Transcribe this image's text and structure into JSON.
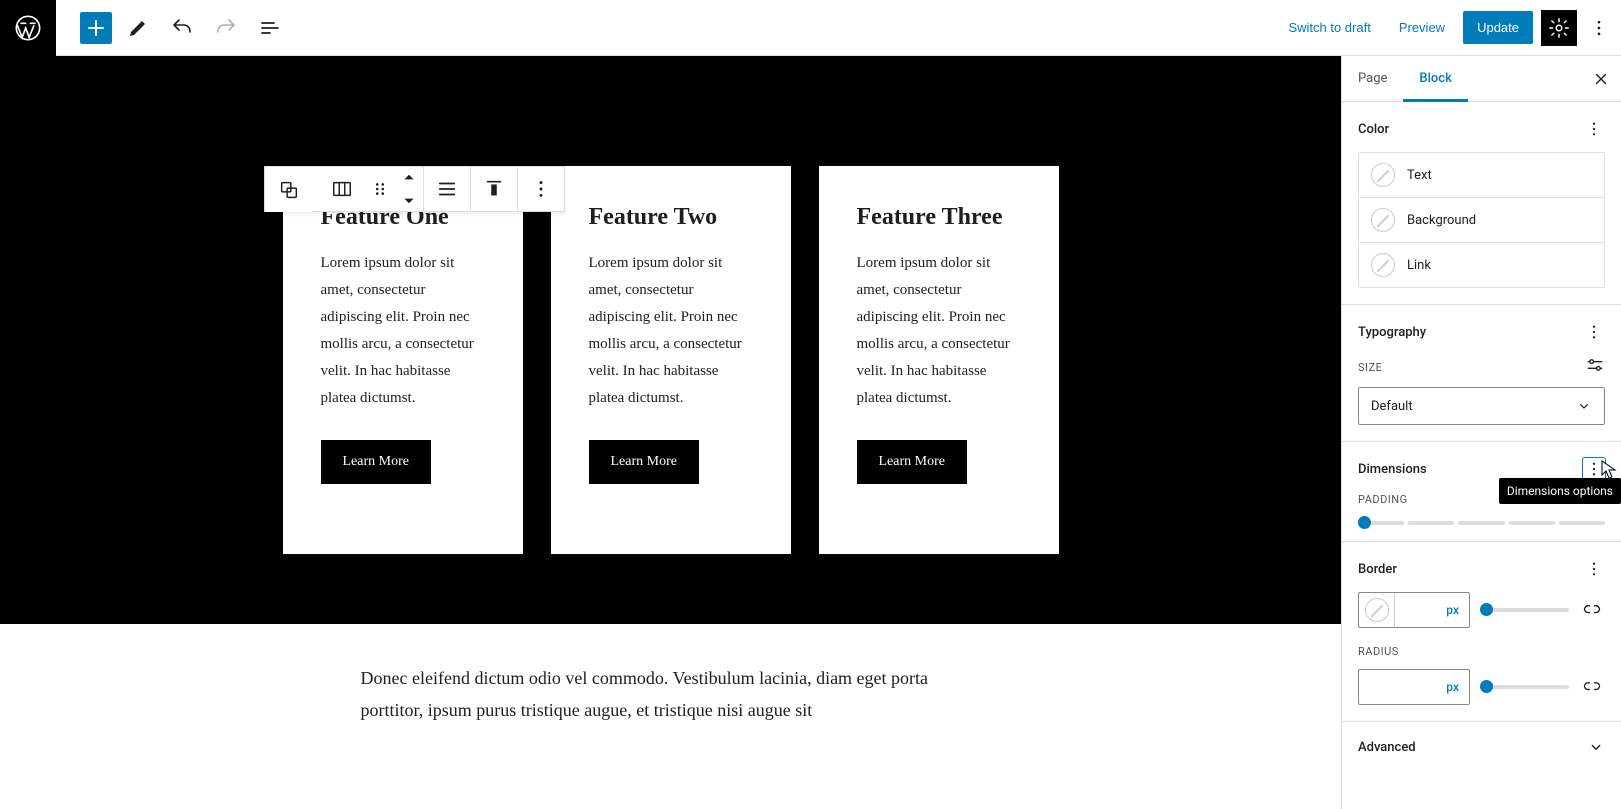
{
  "topbar": {
    "switch_to_draft": "Switch to draft",
    "preview": "Preview",
    "update": "Update"
  },
  "canvas": {
    "columns": [
      {
        "title": "Feature One",
        "body": "Lorem ipsum dolor sit amet, consectetur adipiscing elit. Proin nec mollis arcu, a consectetur velit. In hac habitasse platea dictumst.",
        "button": "Learn More"
      },
      {
        "title": "Feature Two",
        "body": "Lorem ipsum dolor sit amet, consectetur adipiscing elit. Proin nec mollis arcu, a consectetur velit. In hac habitasse platea dictumst.",
        "button": "Learn More"
      },
      {
        "title": "Feature Three",
        "body": "Lorem ipsum dolor sit amet, consectetur adipiscing elit. Proin nec mollis arcu, a consectetur velit. In hac habitasse platea dictumst.",
        "button": "Learn More"
      }
    ],
    "lower_paragraph": "Donec eleifend dictum odio vel commodo. Vestibulum lacinia, diam eget porta porttitor, ipsum purus tristique augue, et tristique nisi augue sit"
  },
  "sidebar": {
    "tabs": {
      "page": "Page",
      "block": "Block"
    },
    "color": {
      "title": "Color",
      "text": "Text",
      "background": "Background",
      "link": "Link"
    },
    "typography": {
      "title": "Typography",
      "size_label": "SIZE",
      "size_value": "Default"
    },
    "dimensions": {
      "title": "Dimensions",
      "padding_label": "PADDING",
      "tooltip": "Dimensions options"
    },
    "border": {
      "title": "Border",
      "unit": "px",
      "radius_label": "RADIUS",
      "radius_unit": "px"
    },
    "advanced": {
      "title": "Advanced"
    }
  }
}
